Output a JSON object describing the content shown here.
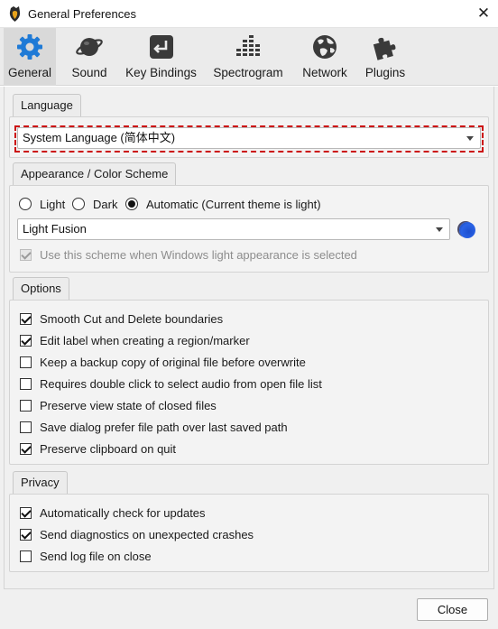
{
  "window": {
    "title": "General Preferences",
    "close_glyph": "✕"
  },
  "toolbar": {
    "items": [
      {
        "label": "General",
        "icon": "gear-icon",
        "active": true
      },
      {
        "label": "Sound",
        "icon": "planet-icon"
      },
      {
        "label": "Key Bindings",
        "icon": "keyboard-return-icon"
      },
      {
        "label": "Spectrogram",
        "icon": "spectrogram-bars-icon"
      },
      {
        "label": "Network",
        "icon": "globe-icon"
      },
      {
        "label": "Plugins",
        "icon": "puzzle-icon"
      }
    ]
  },
  "language": {
    "title": "Language",
    "value": "System Language (简体中文)"
  },
  "appearance": {
    "title": "Appearance / Color Scheme",
    "radios": [
      {
        "label": "Light",
        "checked": false
      },
      {
        "label": "Dark",
        "checked": false
      },
      {
        "label": "Automatic (Current theme is light)",
        "checked": true
      }
    ],
    "scheme_value": "Light Fusion",
    "scheme_checkbox": {
      "label": "Use this scheme when Windows light appearance is selected",
      "checked": true,
      "disabled": true
    },
    "accent_color": "#2a63e6"
  },
  "options": {
    "title": "Options",
    "items": [
      {
        "label": "Smooth Cut and Delete boundaries",
        "checked": true
      },
      {
        "label": "Edit label when creating a region/marker",
        "checked": true
      },
      {
        "label": "Keep a backup copy of original file before overwrite",
        "checked": false
      },
      {
        "label": "Requires double click to select audio from open file list",
        "checked": false
      },
      {
        "label": "Preserve view state of closed files",
        "checked": false
      },
      {
        "label": "Save dialog prefer file path over last saved path",
        "checked": false
      },
      {
        "label": "Preserve clipboard on quit",
        "checked": true
      }
    ]
  },
  "privacy": {
    "title": "Privacy",
    "items": [
      {
        "label": "Automatically check for updates",
        "checked": true
      },
      {
        "label": "Send diagnostics on unexpected crashes",
        "checked": true
      },
      {
        "label": "Send log file on close",
        "checked": false
      }
    ]
  },
  "footer": {
    "close_label": "Close"
  },
  "colors": {
    "icon_blue": "#1f7ad6",
    "icon_dark": "#3a3a3a",
    "highlight_red": "#cc1111"
  }
}
